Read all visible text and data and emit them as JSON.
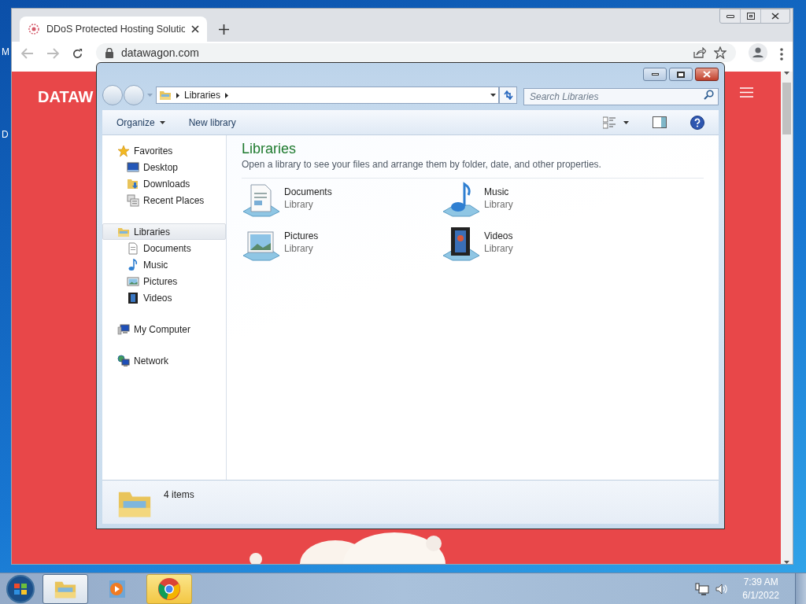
{
  "desktop": {
    "icon_labels": [
      "M",
      "D"
    ]
  },
  "browser": {
    "tab_title": "DDoS Protected Hosting Solutio",
    "address": "datawagon.com",
    "logo": "DATAW"
  },
  "explorer": {
    "breadcrumb": [
      "Libraries"
    ],
    "search": {
      "placeholder": "Search Libraries"
    },
    "commands": [
      {
        "label": "Organize",
        "kind": "menu"
      },
      {
        "label": "New library",
        "kind": "plain"
      }
    ],
    "navigation": [
      {
        "label": "Favorites",
        "selected": false,
        "children": [
          {
            "label": "Desktop",
            "selected": false
          },
          {
            "label": "Downloads",
            "selected": false
          },
          {
            "label": "Recent Places",
            "selected": false
          }
        ]
      },
      {
        "label": "Libraries",
        "selected": true,
        "children": [
          {
            "label": "Documents",
            "selected": false
          },
          {
            "label": "Music",
            "selected": false
          },
          {
            "label": "Pictures",
            "selected": false
          },
          {
            "label": "Videos",
            "selected": false
          }
        ]
      },
      {
        "label": "My Computer",
        "selected": false
      },
      {
        "label": "Network",
        "selected": false
      }
    ],
    "heading": "Libraries",
    "description": "Open a library to see your files and arrange them by folder, date, and other properties.",
    "items": [
      {
        "name": "Documents",
        "type": "Library"
      },
      {
        "name": "Music",
        "type": "Library"
      },
      {
        "name": "Pictures",
        "type": "Library"
      },
      {
        "name": "Videos",
        "type": "Library"
      }
    ],
    "status": "4 items"
  },
  "taskbar": {
    "apps": [
      {
        "selected": true,
        "flashing": false
      },
      {
        "selected": false,
        "flashing": false
      },
      {
        "selected": false,
        "flashing": true
      }
    ],
    "time": "7:39 AM",
    "date": "6/1/2022"
  }
}
